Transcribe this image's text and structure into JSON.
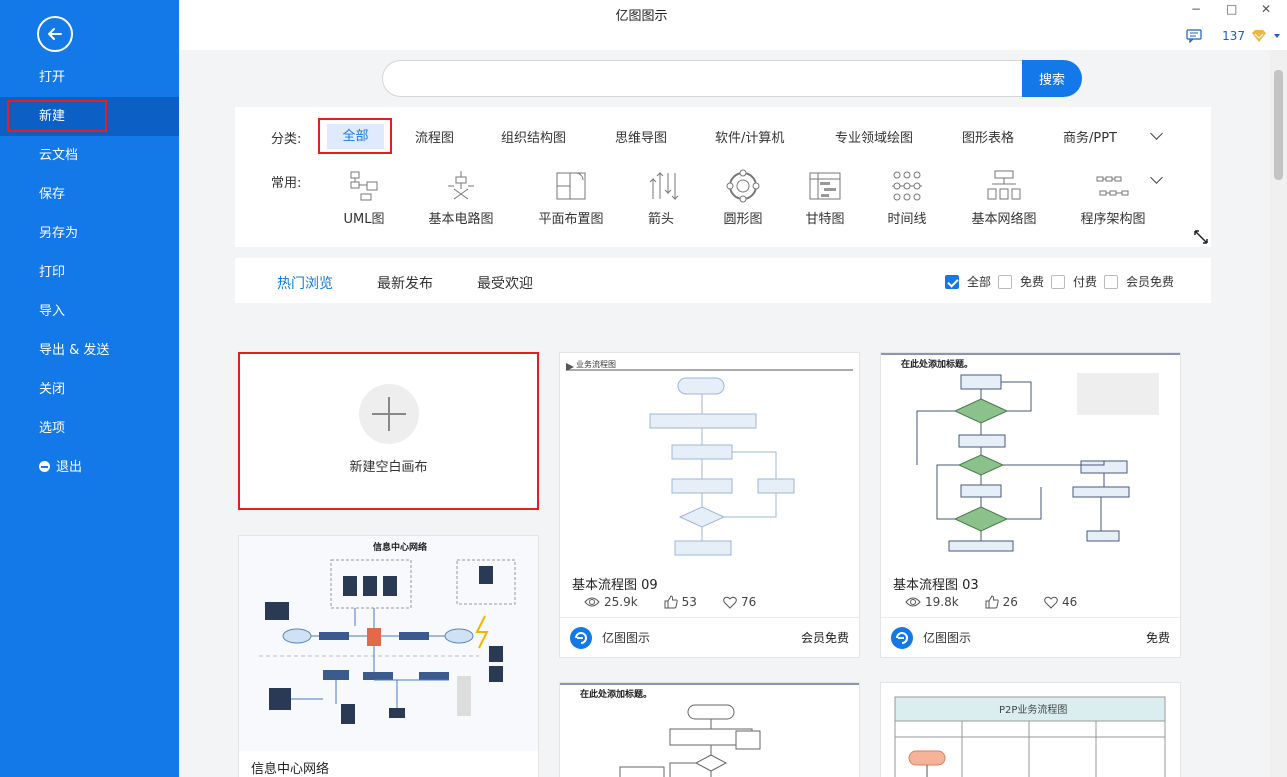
{
  "window": {
    "title": "亿图图示",
    "minimize": "−",
    "maximize": "□",
    "close": "✕"
  },
  "user": {
    "count": "137"
  },
  "sidebar": {
    "items": [
      {
        "label": "打开"
      },
      {
        "label": "新建",
        "active": true
      },
      {
        "label": "云文档"
      },
      {
        "label": "保存"
      },
      {
        "label": "另存为"
      },
      {
        "label": "打印"
      },
      {
        "label": "导入"
      },
      {
        "label": "导出 & 发送"
      },
      {
        "label": "关闭"
      },
      {
        "label": "选项"
      },
      {
        "label": "退出"
      }
    ]
  },
  "search": {
    "placeholder": "",
    "button": "搜索"
  },
  "categories": {
    "label": "分类:",
    "items": [
      "全部",
      "流程图",
      "组织结构图",
      "思维导图",
      "软件/计算机",
      "专业领域绘图",
      "图形表格",
      "商务/PPT"
    ],
    "selected": "全部"
  },
  "common": {
    "label": "常用:",
    "items": [
      {
        "label": "UML图",
        "icon": "uml-icon"
      },
      {
        "label": "基本电路图",
        "icon": "circuit-icon"
      },
      {
        "label": "平面布置图",
        "icon": "floorplan-icon"
      },
      {
        "label": "箭头",
        "icon": "arrow-shapes-icon"
      },
      {
        "label": "圆形图",
        "icon": "circle-diagram-icon"
      },
      {
        "label": "甘特图",
        "icon": "gantt-icon"
      },
      {
        "label": "时间线",
        "icon": "timeline-icon"
      },
      {
        "label": "基本网络图",
        "icon": "network-icon"
      },
      {
        "label": "程序架构图",
        "icon": "architecture-icon"
      }
    ]
  },
  "tabs": {
    "items": [
      "热门浏览",
      "最新发布",
      "最受欢迎"
    ],
    "active": "热门浏览"
  },
  "filters": [
    {
      "label": "全部",
      "checked": true
    },
    {
      "label": "免费",
      "checked": false
    },
    {
      "label": "付费",
      "checked": false
    },
    {
      "label": "会员免费",
      "checked": false
    }
  ],
  "new_blank": {
    "label": "新建空白画布"
  },
  "templates": [
    {
      "title": "基本流程图 09",
      "views": "25.9k",
      "likes": "53",
      "favs": "76",
      "author": "亿图图示",
      "price": "会员免费",
      "thumb_heading": "业务流程图"
    },
    {
      "title": "基本流程图 03",
      "views": "19.8k",
      "likes": "26",
      "favs": "46",
      "author": "亿图图示",
      "price": "免费",
      "thumb_heading": "在此处添加标题。"
    },
    {
      "title": "信息中心网络",
      "thumb_heading": "信息中心网络"
    },
    {
      "thumb_heading": "在此处添加标题。"
    },
    {
      "thumb_heading": "P2P业务流程图"
    }
  ]
}
